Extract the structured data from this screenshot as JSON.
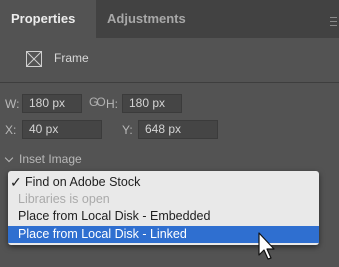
{
  "tabs": [
    {
      "label": "Properties",
      "active": true
    },
    {
      "label": "Adjustments",
      "active": false
    }
  ],
  "frame": {
    "label": "Frame",
    "icon": "frame-icon"
  },
  "transform": {
    "w_label": "W:",
    "w_value": "180 px",
    "h_label": "H:",
    "h_value": "180 px",
    "x_label": "X:",
    "x_value": "40 px",
    "y_label": "Y:",
    "y_value": "648 px",
    "link_glyph": "GO"
  },
  "section": {
    "label": "Inset Image"
  },
  "menu": {
    "items": [
      {
        "label": "Find on Adobe Stock",
        "checked": true
      },
      {
        "label": "Libraries is open",
        "disabled": true
      },
      {
        "label": "Place from Local Disk - Embedded"
      },
      {
        "label": "Place from Local Disk - Linked",
        "selected": true
      }
    ]
  },
  "colors": {
    "panel": "#535353",
    "menu_bg": "#e9e9e9",
    "selection": "#2f6fd0"
  }
}
